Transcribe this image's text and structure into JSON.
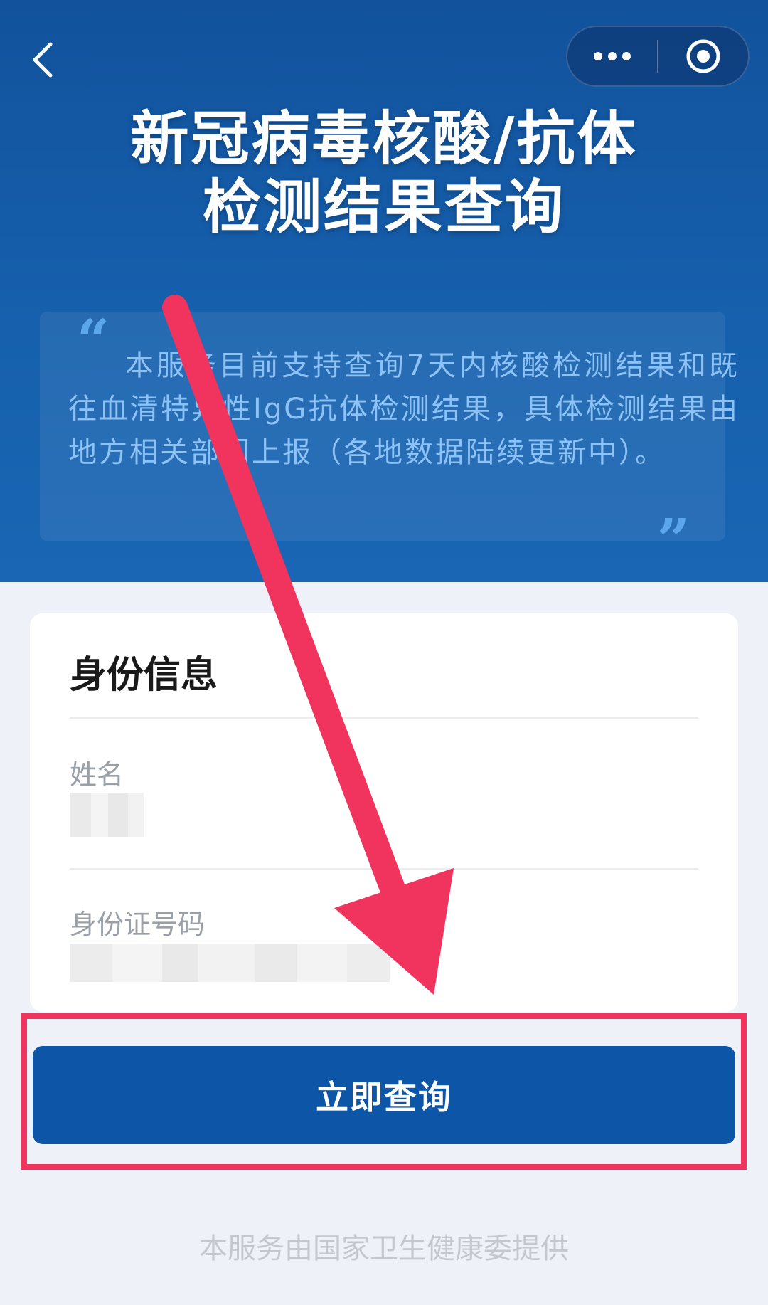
{
  "header": {
    "title_line1": "新冠病毒核酸/抗体",
    "title_line2": "检测结果查询",
    "back_icon": "chevron-left-icon",
    "more_icon": "more-dots-icon",
    "close_icon": "target-close-icon"
  },
  "notice": {
    "quote_open": "“",
    "quote_close": "”",
    "text": "本服务目前支持查询7天内核酸检测结果和既往血清特异性IgG抗体检测结果，具体检测结果由地方相关部门上报（各地数据陆续更新中）。"
  },
  "form": {
    "title": "身份信息",
    "name_label": "姓名",
    "id_label": "身份证号码"
  },
  "actions": {
    "query_label": "立即查询"
  },
  "footer": {
    "text": "本服务由国家卫生健康委提供"
  },
  "colors": {
    "header_blue": "#12529c",
    "button_blue": "#0d55a6",
    "annotation_red": "#f0345e"
  }
}
